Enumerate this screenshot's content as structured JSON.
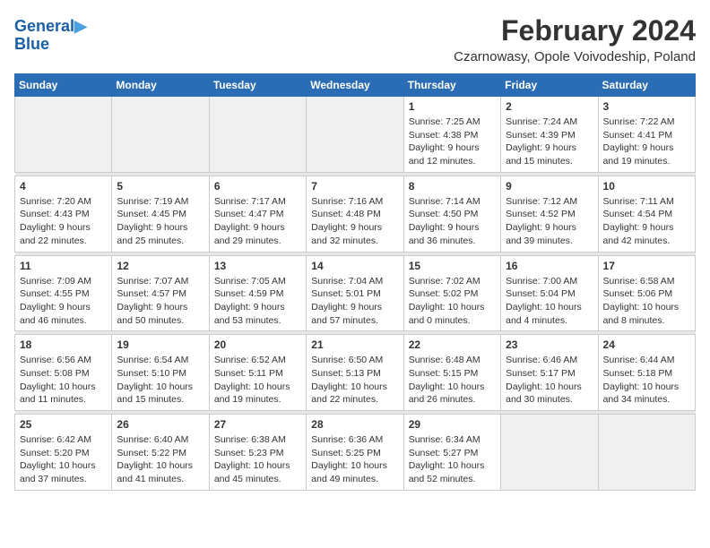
{
  "header": {
    "logo_line1": "General",
    "logo_line2": "Blue",
    "month_title": "February 2024",
    "location": "Czarnowasy, Opole Voivodeship, Poland"
  },
  "weekdays": [
    "Sunday",
    "Monday",
    "Tuesday",
    "Wednesday",
    "Thursday",
    "Friday",
    "Saturday"
  ],
  "weeks": [
    [
      {
        "day": "",
        "empty": true
      },
      {
        "day": "",
        "empty": true
      },
      {
        "day": "",
        "empty": true
      },
      {
        "day": "",
        "empty": true
      },
      {
        "day": "1",
        "sunrise": "7:25 AM",
        "sunset": "4:38 PM",
        "daylight": "9 hours and 12 minutes."
      },
      {
        "day": "2",
        "sunrise": "7:24 AM",
        "sunset": "4:39 PM",
        "daylight": "9 hours and 15 minutes."
      },
      {
        "day": "3",
        "sunrise": "7:22 AM",
        "sunset": "4:41 PM",
        "daylight": "9 hours and 19 minutes."
      }
    ],
    [
      {
        "day": "4",
        "sunrise": "7:20 AM",
        "sunset": "4:43 PM",
        "daylight": "9 hours and 22 minutes."
      },
      {
        "day": "5",
        "sunrise": "7:19 AM",
        "sunset": "4:45 PM",
        "daylight": "9 hours and 25 minutes."
      },
      {
        "day": "6",
        "sunrise": "7:17 AM",
        "sunset": "4:47 PM",
        "daylight": "9 hours and 29 minutes."
      },
      {
        "day": "7",
        "sunrise": "7:16 AM",
        "sunset": "4:48 PM",
        "daylight": "9 hours and 32 minutes."
      },
      {
        "day": "8",
        "sunrise": "7:14 AM",
        "sunset": "4:50 PM",
        "daylight": "9 hours and 36 minutes."
      },
      {
        "day": "9",
        "sunrise": "7:12 AM",
        "sunset": "4:52 PM",
        "daylight": "9 hours and 39 minutes."
      },
      {
        "day": "10",
        "sunrise": "7:11 AM",
        "sunset": "4:54 PM",
        "daylight": "9 hours and 42 minutes."
      }
    ],
    [
      {
        "day": "11",
        "sunrise": "7:09 AM",
        "sunset": "4:55 PM",
        "daylight": "9 hours and 46 minutes."
      },
      {
        "day": "12",
        "sunrise": "7:07 AM",
        "sunset": "4:57 PM",
        "daylight": "9 hours and 50 minutes."
      },
      {
        "day": "13",
        "sunrise": "7:05 AM",
        "sunset": "4:59 PM",
        "daylight": "9 hours and 53 minutes."
      },
      {
        "day": "14",
        "sunrise": "7:04 AM",
        "sunset": "5:01 PM",
        "daylight": "9 hours and 57 minutes."
      },
      {
        "day": "15",
        "sunrise": "7:02 AM",
        "sunset": "5:02 PM",
        "daylight": "10 hours and 0 minutes."
      },
      {
        "day": "16",
        "sunrise": "7:00 AM",
        "sunset": "5:04 PM",
        "daylight": "10 hours and 4 minutes."
      },
      {
        "day": "17",
        "sunrise": "6:58 AM",
        "sunset": "5:06 PM",
        "daylight": "10 hours and 8 minutes."
      }
    ],
    [
      {
        "day": "18",
        "sunrise": "6:56 AM",
        "sunset": "5:08 PM",
        "daylight": "10 hours and 11 minutes."
      },
      {
        "day": "19",
        "sunrise": "6:54 AM",
        "sunset": "5:10 PM",
        "daylight": "10 hours and 15 minutes."
      },
      {
        "day": "20",
        "sunrise": "6:52 AM",
        "sunset": "5:11 PM",
        "daylight": "10 hours and 19 minutes."
      },
      {
        "day": "21",
        "sunrise": "6:50 AM",
        "sunset": "5:13 PM",
        "daylight": "10 hours and 22 minutes."
      },
      {
        "day": "22",
        "sunrise": "6:48 AM",
        "sunset": "5:15 PM",
        "daylight": "10 hours and 26 minutes."
      },
      {
        "day": "23",
        "sunrise": "6:46 AM",
        "sunset": "5:17 PM",
        "daylight": "10 hours and 30 minutes."
      },
      {
        "day": "24",
        "sunrise": "6:44 AM",
        "sunset": "5:18 PM",
        "daylight": "10 hours and 34 minutes."
      }
    ],
    [
      {
        "day": "25",
        "sunrise": "6:42 AM",
        "sunset": "5:20 PM",
        "daylight": "10 hours and 37 minutes."
      },
      {
        "day": "26",
        "sunrise": "6:40 AM",
        "sunset": "5:22 PM",
        "daylight": "10 hours and 41 minutes."
      },
      {
        "day": "27",
        "sunrise": "6:38 AM",
        "sunset": "5:23 PM",
        "daylight": "10 hours and 45 minutes."
      },
      {
        "day": "28",
        "sunrise": "6:36 AM",
        "sunset": "5:25 PM",
        "daylight": "10 hours and 49 minutes."
      },
      {
        "day": "29",
        "sunrise": "6:34 AM",
        "sunset": "5:27 PM",
        "daylight": "10 hours and 52 minutes."
      },
      {
        "day": "",
        "empty": true
      },
      {
        "day": "",
        "empty": true
      }
    ]
  ]
}
